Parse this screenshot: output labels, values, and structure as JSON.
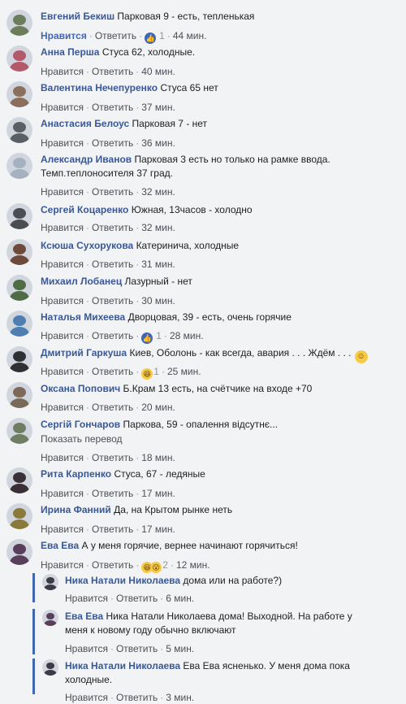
{
  "labels": {
    "like": "Нравится",
    "reply": "Ответить",
    "dot": "·"
  },
  "comments": [
    {
      "author": "Евгений Бекиш",
      "text": "Парковая 9 - есть, тепленькая",
      "time": "44 мин.",
      "liked": true,
      "reaction_count": "1",
      "reaction_icons": [
        "like-icon"
      ],
      "avatar_color": "#6b7d5a"
    },
    {
      "author": "Анна Перша",
      "text": "Стуса 62, холодные.",
      "time": "40 мин.",
      "avatar_color": "#b35a6a"
    },
    {
      "author": "Валентина Нечепуренко",
      "text": "Стуса 65 нет",
      "time": "37 мин.",
      "avatar_color": "#8a6f5c"
    },
    {
      "author": "Анастасия Белоус",
      "text": "Парковая 7 - нет",
      "time": "36 мин.",
      "avatar_color": "#5a5f66"
    },
    {
      "author": "Александр Иванов",
      "text": "Парковая 3 есть но только на рамке ввода.\nТемп.теплоносителя 37 град.",
      "time": "32 мин.",
      "avatar_color": "#a6b1bf"
    },
    {
      "author": "Сергей Коцаренко",
      "text": "Южная, 13часов - холодно",
      "time": "32 мин.",
      "avatar_color": "#4a4d52"
    },
    {
      "author": "Ксюша Сухорукова",
      "text": "Катериничa, холодные",
      "time": "31 мин.",
      "avatar_color": "#6e4a3a"
    },
    {
      "author": "Михаил Лобанец",
      "text": "Лазурный - нет",
      "time": "30 мин.",
      "avatar_color": "#4f6b45"
    },
    {
      "author": "Наталья Михеева",
      "text": "Дворцовая, 39 - есть, очень горячие",
      "time": "28 мин.",
      "reaction_count": "1",
      "reaction_icons": [
        "like-icon"
      ],
      "avatar_color": "#4e7fb0"
    },
    {
      "author": "Дмитрий Гаркуша",
      "text": "Киев, Оболонь - как всегда, авария . . . Ждём . . .",
      "smile": true,
      "time": "25 мин.",
      "reaction_count": "1",
      "reaction_icons": [
        "haha-icon"
      ],
      "avatar_color": "#2f3033"
    },
    {
      "author": "Оксана Попович",
      "text": "Б.Крам 13 есть, на счётчике на входе +70",
      "time": "20 мин.",
      "avatar_color": "#7b6a5a"
    },
    {
      "author": "Сергій Гончаров",
      "text": "Паркова, 59 - опалення відсутнє...",
      "translate": "Показать перевод",
      "time": "18 мин.",
      "avatar_color": "#6f7d63"
    },
    {
      "author": "Рита Карпенко",
      "text": "Стуса, 67 - ледяные",
      "time": "17 мин.",
      "avatar_color": "#3a2f34"
    },
    {
      "author": "Ирина Фанний",
      "text": "Да, на Крытом рынке неть",
      "time": "17 мин.",
      "avatar_color": "#8a7a3a"
    },
    {
      "author": "Ева Ева",
      "text": "А у меня горячие, вернее начинают горячиться!",
      "time": "12 мин.",
      "reaction_count": "2",
      "reaction_icons": [
        "haha-icon",
        "wow-icon"
      ],
      "avatar_color": "#5a3f5c"
    }
  ],
  "replies": [
    {
      "author": "Ника Натали Николаева",
      "text": "дома или на работе?)",
      "time": "6 мин.",
      "avatar_color": "#3d3a48"
    },
    {
      "author": "Ева Ева",
      "text": "Ника Натали Николаева дома! Выходной. На работе у\nменя к новому году обычно включают",
      "time": "5 мин.",
      "avatar_color": "#5a3f5c"
    },
    {
      "author": "Ника Натали Николаева",
      "text": "Ева Ева ясненько. У меня дома пока\nхолодные.",
      "time": "3 мин.",
      "avatar_color": "#3d3a48"
    }
  ]
}
